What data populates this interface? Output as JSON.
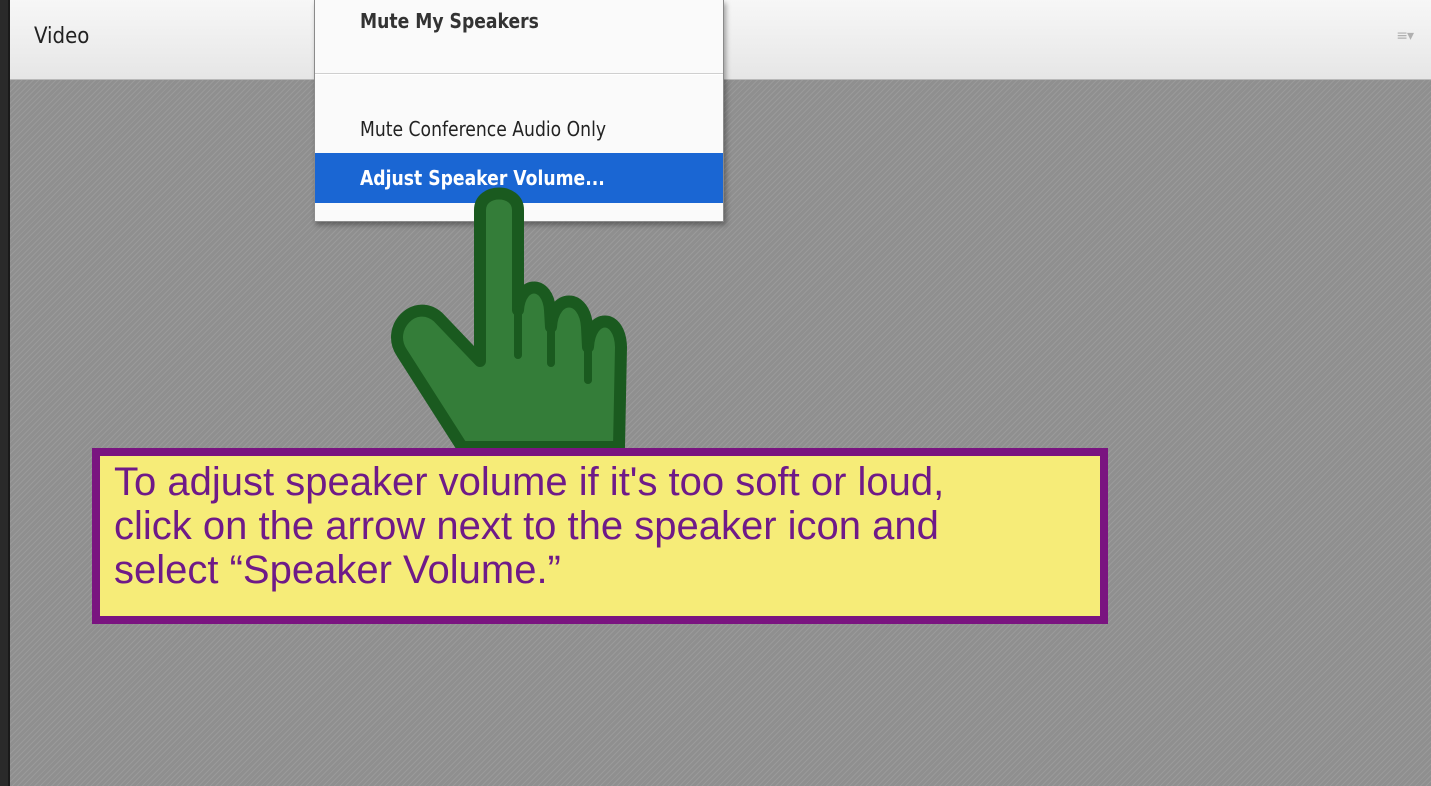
{
  "pod": {
    "title": "Video",
    "options_icon": "menu-lines-icon"
  },
  "menu": {
    "items": [
      {
        "label": "Mute My Speakers"
      },
      {
        "label": "Mute Conference Audio Only"
      },
      {
        "label": "Adjust Speaker Volume..."
      }
    ],
    "selected": "Adjust Speaker Volume..."
  },
  "pointer": {
    "icon": "pointing-hand-icon",
    "fill_color": "#347d39",
    "outline_color": "#1a5a1f"
  },
  "callout": {
    "text": "To adjust speaker volume if it's too soft or loud, click on the arrow next to the speaker icon and select “Speaker Volume.”",
    "background_color": "#f6ec78",
    "border_color": "#7a1480",
    "text_color": "#6f1a88"
  }
}
